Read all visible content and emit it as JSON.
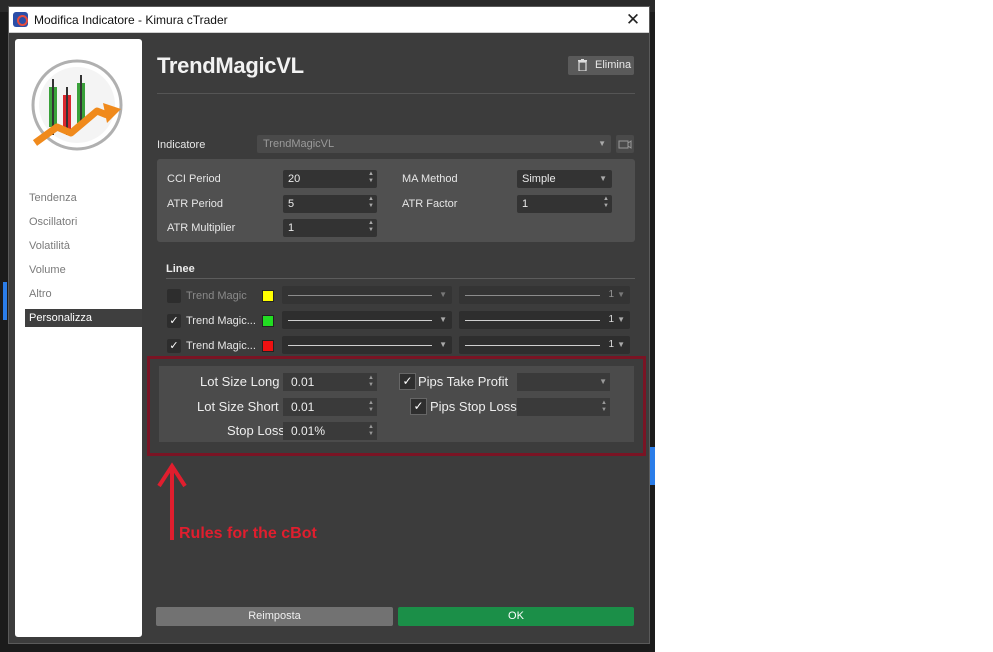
{
  "window": {
    "title": "Modifica Indicatore - Kimura cTrader",
    "close_glyph": "✕"
  },
  "sidebar": {
    "items": [
      {
        "label": "Tendenza"
      },
      {
        "label": "Oscillatori"
      },
      {
        "label": "Volatilità"
      },
      {
        "label": "Volume"
      },
      {
        "label": "Altro"
      },
      {
        "label": "Personalizza",
        "active": true
      }
    ]
  },
  "header": {
    "title": "TrendMagicVL",
    "delete_label": "Elimina"
  },
  "indicator": {
    "label": "Indicatore",
    "value": "TrendMagicVL"
  },
  "params": {
    "cci_period": {
      "label": "CCI Period",
      "value": "20"
    },
    "atr_period": {
      "label": "ATR Period",
      "value": "5"
    },
    "atr_multiplier": {
      "label": "ATR Multiplier",
      "value": "1"
    },
    "ma_method": {
      "label": "MA Method",
      "value": "Simple"
    },
    "atr_factor": {
      "label": "ATR Factor",
      "value": "1"
    }
  },
  "lines": {
    "title": "Linee",
    "items": [
      {
        "label": "Trend Magic",
        "checked": false,
        "color": "#ffff00",
        "thickness": "1"
      },
      {
        "label": "Trend Magic...",
        "checked": true,
        "color": "#22dd22",
        "thickness": "1"
      },
      {
        "label": "Trend Magic...",
        "checked": true,
        "color": "#ee1111",
        "thickness": "1"
      }
    ]
  },
  "rules": {
    "lot_size_long": {
      "label": "Lot Size Long",
      "value": "0.01"
    },
    "lot_size_short": {
      "label": "Lot Size Short",
      "value": "0.01"
    },
    "stop_loss": {
      "label": "Stop Loss",
      "value": "0.01%"
    },
    "pips_take_profit": {
      "label": "Pips Take Profit",
      "checked": true,
      "value": ""
    },
    "pips_stop_loss": {
      "label": "Pips Stop Loss",
      "checked": true,
      "value": ""
    }
  },
  "annotation": {
    "text": "Rules for the cBot",
    "color": "#e01e2e"
  },
  "footer": {
    "reset_label": "Reimposta",
    "ok_label": "OK"
  },
  "colors": {
    "ok_green": "#1b8f48",
    "frame": "#7a1424",
    "dialog_bg": "#3c3c3c"
  }
}
